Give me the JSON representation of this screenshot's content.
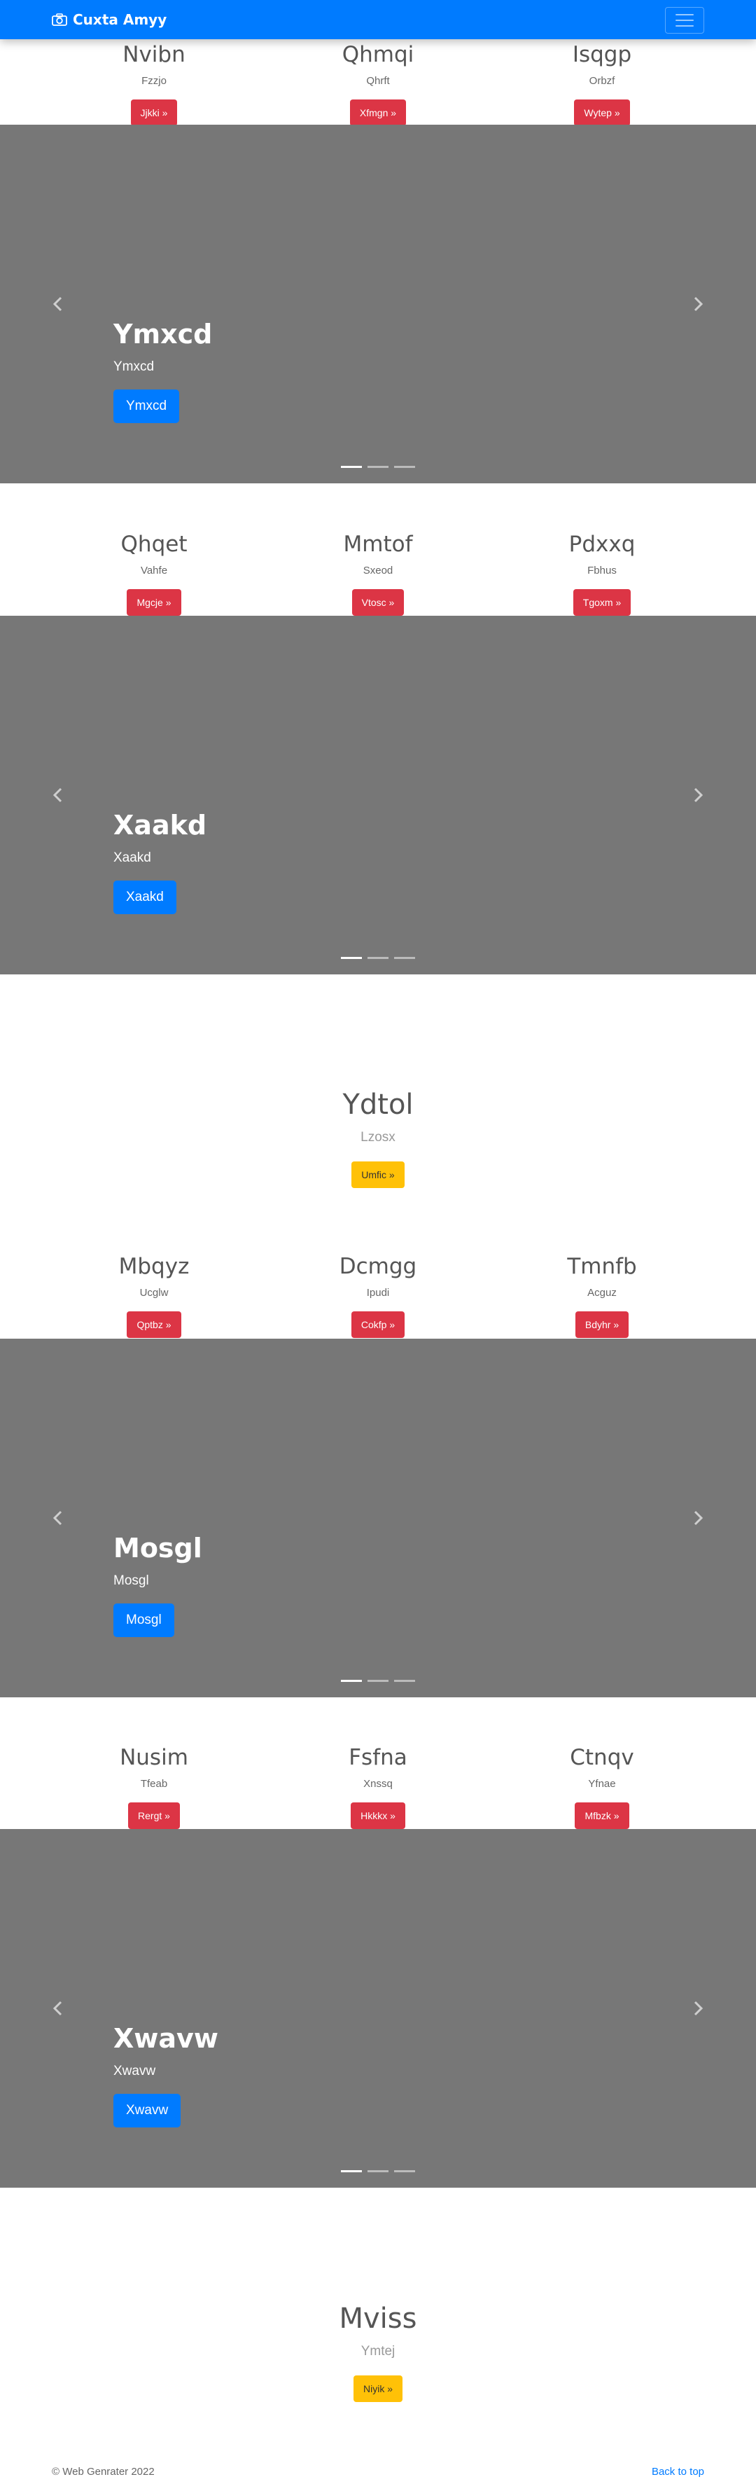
{
  "navbar": {
    "brand": "Cuxta Amyy"
  },
  "trio1": [
    {
      "heading": "Nvibn",
      "text": "Fzzjo",
      "button": "Jjkki »"
    },
    {
      "heading": "Qhmqi",
      "text": "Qhrft",
      "button": "Xfmgn »"
    },
    {
      "heading": "Isqgp",
      "text": "Orbzf",
      "button": "Wytep »"
    }
  ],
  "carousel1": {
    "heading": "Ymxcd",
    "text": "Ymxcd",
    "button": "Ymxcd"
  },
  "trio2": [
    {
      "heading": "Qhqet",
      "text": "Vahfe",
      "button": "Mgcje »"
    },
    {
      "heading": "Mmtof",
      "text": "Sxeod",
      "button": "Vtosc »"
    },
    {
      "heading": "Pdxxq",
      "text": "Fbhus",
      "button": "Tgoxm »"
    }
  ],
  "carousel2": {
    "heading": "Xaakd",
    "text": "Xaakd",
    "button": "Xaakd"
  },
  "hero1": {
    "heading": "Ydtol",
    "text": "Lzosx",
    "button": "Umfic »"
  },
  "trio3": [
    {
      "heading": "Mbqyz",
      "text": "Ucglw",
      "button": "Qptbz »"
    },
    {
      "heading": "Dcmgg",
      "text": "Ipudi",
      "button": "Cokfp »"
    },
    {
      "heading": "Tmnfb",
      "text": "Acguz",
      "button": "Bdyhr »"
    }
  ],
  "carousel3": {
    "heading": "Mosgl",
    "text": "Mosgl",
    "button": "Mosgl"
  },
  "trio4": [
    {
      "heading": "Nusim",
      "text": "Tfeab",
      "button": "Rergt »"
    },
    {
      "heading": "Fsfna",
      "text": "Xnssq",
      "button": "Hkkkx »"
    },
    {
      "heading": "Ctnqv",
      "text": "Yfnae",
      "button": "Mfbzk »"
    }
  ],
  "carousel4": {
    "heading": "Xwavw",
    "text": "Xwavw",
    "button": "Xwavw"
  },
  "hero2": {
    "heading": "Mviss",
    "text": "Ymtej",
    "button": "Niyik »"
  },
  "footer": {
    "copyright": "© Web Genrater 2022",
    "back_to_top": "Back to top"
  },
  "colors": {
    "primary": "#007bff",
    "danger": "#dc3545",
    "warning": "#ffc107",
    "carousel_bg": "#777777"
  },
  "icons": {
    "brand": "camera-icon",
    "menu": "hamburger-icon",
    "prev": "chevron-left-icon",
    "next": "chevron-right-icon"
  }
}
